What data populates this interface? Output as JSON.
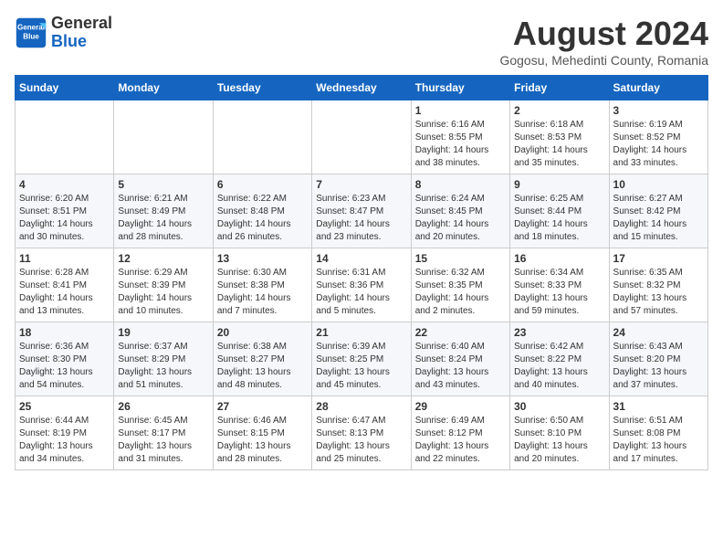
{
  "header": {
    "logo_line1": "General",
    "logo_line2": "Blue",
    "month_title": "August 2024",
    "location": "Gogosu, Mehedinti County, Romania"
  },
  "weekdays": [
    "Sunday",
    "Monday",
    "Tuesday",
    "Wednesday",
    "Thursday",
    "Friday",
    "Saturday"
  ],
  "weeks": [
    [
      {
        "day": "",
        "info": ""
      },
      {
        "day": "",
        "info": ""
      },
      {
        "day": "",
        "info": ""
      },
      {
        "day": "",
        "info": ""
      },
      {
        "day": "1",
        "info": "Sunrise: 6:16 AM\nSunset: 8:55 PM\nDaylight: 14 hours\nand 38 minutes."
      },
      {
        "day": "2",
        "info": "Sunrise: 6:18 AM\nSunset: 8:53 PM\nDaylight: 14 hours\nand 35 minutes."
      },
      {
        "day": "3",
        "info": "Sunrise: 6:19 AM\nSunset: 8:52 PM\nDaylight: 14 hours\nand 33 minutes."
      }
    ],
    [
      {
        "day": "4",
        "info": "Sunrise: 6:20 AM\nSunset: 8:51 PM\nDaylight: 14 hours\nand 30 minutes."
      },
      {
        "day": "5",
        "info": "Sunrise: 6:21 AM\nSunset: 8:49 PM\nDaylight: 14 hours\nand 28 minutes."
      },
      {
        "day": "6",
        "info": "Sunrise: 6:22 AM\nSunset: 8:48 PM\nDaylight: 14 hours\nand 26 minutes."
      },
      {
        "day": "7",
        "info": "Sunrise: 6:23 AM\nSunset: 8:47 PM\nDaylight: 14 hours\nand 23 minutes."
      },
      {
        "day": "8",
        "info": "Sunrise: 6:24 AM\nSunset: 8:45 PM\nDaylight: 14 hours\nand 20 minutes."
      },
      {
        "day": "9",
        "info": "Sunrise: 6:25 AM\nSunset: 8:44 PM\nDaylight: 14 hours\nand 18 minutes."
      },
      {
        "day": "10",
        "info": "Sunrise: 6:27 AM\nSunset: 8:42 PM\nDaylight: 14 hours\nand 15 minutes."
      }
    ],
    [
      {
        "day": "11",
        "info": "Sunrise: 6:28 AM\nSunset: 8:41 PM\nDaylight: 14 hours\nand 13 minutes."
      },
      {
        "day": "12",
        "info": "Sunrise: 6:29 AM\nSunset: 8:39 PM\nDaylight: 14 hours\nand 10 minutes."
      },
      {
        "day": "13",
        "info": "Sunrise: 6:30 AM\nSunset: 8:38 PM\nDaylight: 14 hours\nand 7 minutes."
      },
      {
        "day": "14",
        "info": "Sunrise: 6:31 AM\nSunset: 8:36 PM\nDaylight: 14 hours\nand 5 minutes."
      },
      {
        "day": "15",
        "info": "Sunrise: 6:32 AM\nSunset: 8:35 PM\nDaylight: 14 hours\nand 2 minutes."
      },
      {
        "day": "16",
        "info": "Sunrise: 6:34 AM\nSunset: 8:33 PM\nDaylight: 13 hours\nand 59 minutes."
      },
      {
        "day": "17",
        "info": "Sunrise: 6:35 AM\nSunset: 8:32 PM\nDaylight: 13 hours\nand 57 minutes."
      }
    ],
    [
      {
        "day": "18",
        "info": "Sunrise: 6:36 AM\nSunset: 8:30 PM\nDaylight: 13 hours\nand 54 minutes."
      },
      {
        "day": "19",
        "info": "Sunrise: 6:37 AM\nSunset: 8:29 PM\nDaylight: 13 hours\nand 51 minutes."
      },
      {
        "day": "20",
        "info": "Sunrise: 6:38 AM\nSunset: 8:27 PM\nDaylight: 13 hours\nand 48 minutes."
      },
      {
        "day": "21",
        "info": "Sunrise: 6:39 AM\nSunset: 8:25 PM\nDaylight: 13 hours\nand 45 minutes."
      },
      {
        "day": "22",
        "info": "Sunrise: 6:40 AM\nSunset: 8:24 PM\nDaylight: 13 hours\nand 43 minutes."
      },
      {
        "day": "23",
        "info": "Sunrise: 6:42 AM\nSunset: 8:22 PM\nDaylight: 13 hours\nand 40 minutes."
      },
      {
        "day": "24",
        "info": "Sunrise: 6:43 AM\nSunset: 8:20 PM\nDaylight: 13 hours\nand 37 minutes."
      }
    ],
    [
      {
        "day": "25",
        "info": "Sunrise: 6:44 AM\nSunset: 8:19 PM\nDaylight: 13 hours\nand 34 minutes."
      },
      {
        "day": "26",
        "info": "Sunrise: 6:45 AM\nSunset: 8:17 PM\nDaylight: 13 hours\nand 31 minutes."
      },
      {
        "day": "27",
        "info": "Sunrise: 6:46 AM\nSunset: 8:15 PM\nDaylight: 13 hours\nand 28 minutes."
      },
      {
        "day": "28",
        "info": "Sunrise: 6:47 AM\nSunset: 8:13 PM\nDaylight: 13 hours\nand 25 minutes."
      },
      {
        "day": "29",
        "info": "Sunrise: 6:49 AM\nSunset: 8:12 PM\nDaylight: 13 hours\nand 22 minutes."
      },
      {
        "day": "30",
        "info": "Sunrise: 6:50 AM\nSunset: 8:10 PM\nDaylight: 13 hours\nand 20 minutes."
      },
      {
        "day": "31",
        "info": "Sunrise: 6:51 AM\nSunset: 8:08 PM\nDaylight: 13 hours\nand 17 minutes."
      }
    ]
  ]
}
